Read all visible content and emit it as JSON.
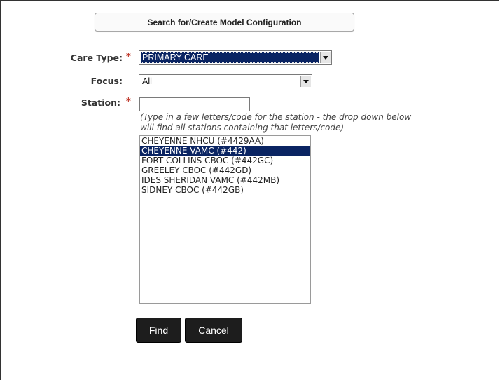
{
  "header": {
    "title": "Search for/Create Model Configuration"
  },
  "form": {
    "care_type": {
      "label": "Care Type:",
      "required_mark": "*",
      "value": "PRIMARY CARE"
    },
    "focus": {
      "label": "Focus:",
      "value": "All"
    },
    "station": {
      "label": "Station:",
      "required_mark": "*",
      "input_value": "",
      "hint": "(Type in a few letters/code for the station - the drop down below will find all stations containing that letters/code)",
      "options": [
        "CHEYENNE NHCU (#4429AA)",
        "CHEYENNE VAMC (#442)",
        "FORT COLLINS CBOC (#442GC)",
        "GREELEY CBOC (#442GD)",
        "IDES SHERIDAN VAMC (#442MB)",
        "SIDNEY CBOC (#442GB)"
      ],
      "selected_option": "CHEYENNE VAMC (#442)"
    }
  },
  "buttons": {
    "find": "Find",
    "cancel": "Cancel"
  },
  "colors": {
    "selection": "#0a2462",
    "required": "#c0392b",
    "button_bg": "#1d1d1d"
  }
}
